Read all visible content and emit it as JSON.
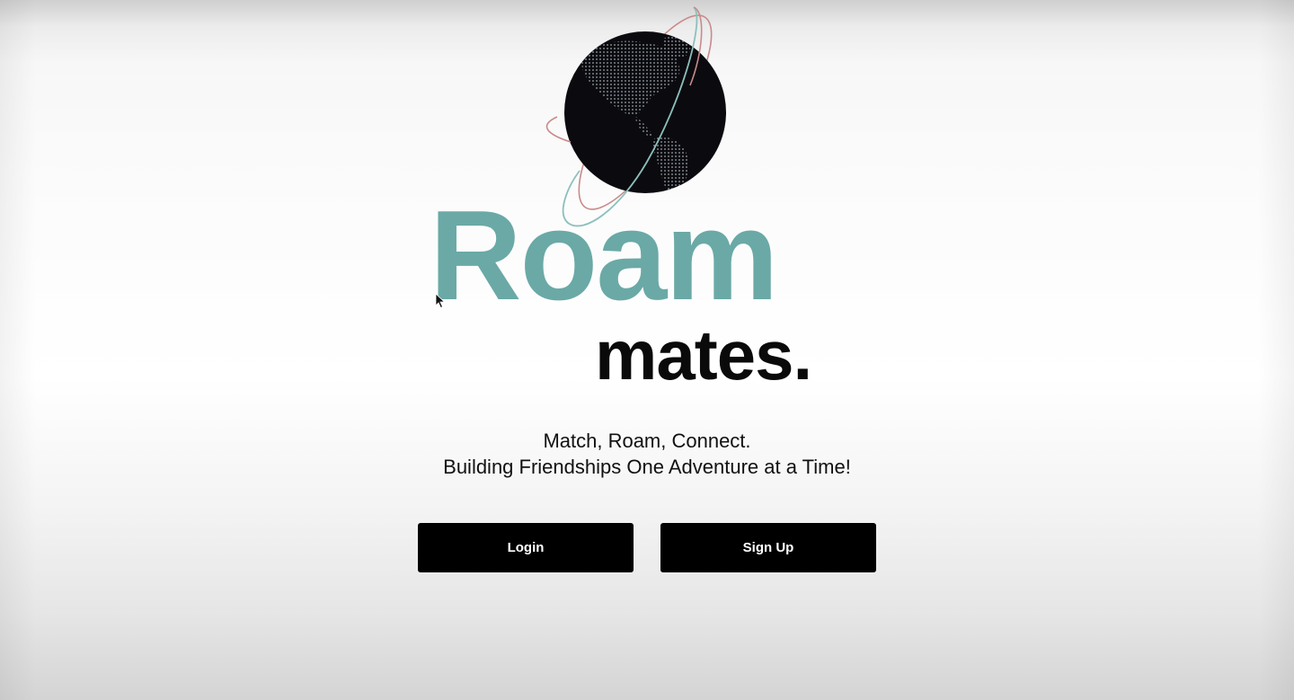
{
  "brand": {
    "name_primary": "Roam",
    "name_secondary": "mates.",
    "primary_color": "#6aa9a6",
    "secondary_color": "#0a0a0a",
    "logo_icon": "globe-icon"
  },
  "tagline": {
    "line1": "Match, Roam, Connect.",
    "line2": "Building Friendships One Adventure at a Time!"
  },
  "actions": {
    "login_label": "Login",
    "signup_label": "Sign Up",
    "button_bg": "#000000",
    "button_fg": "#ffffff"
  }
}
